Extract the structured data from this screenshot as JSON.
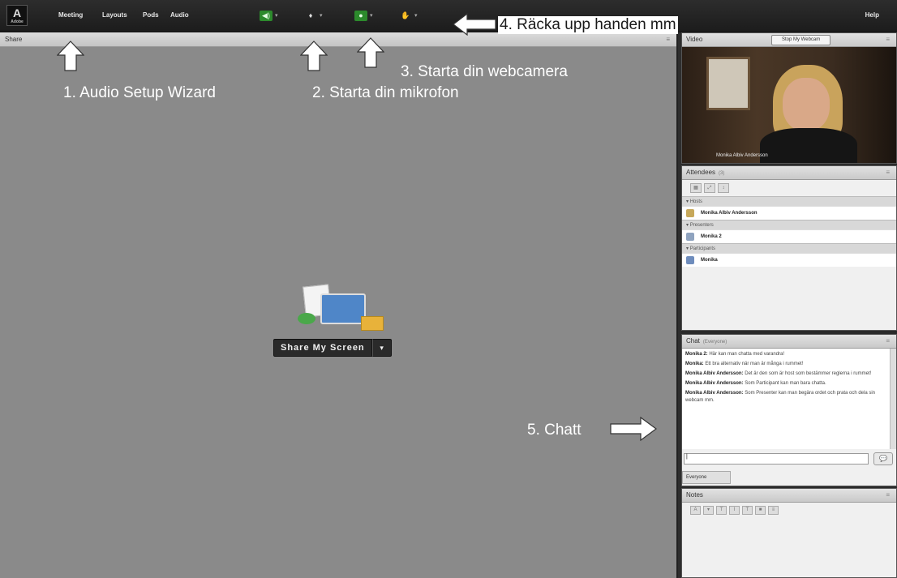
{
  "menubar": {
    "logo_text": "Adobe",
    "items": [
      "Meeting",
      "Layouts",
      "Pods",
      "Audio"
    ],
    "help": "Help"
  },
  "share": {
    "title": "Share",
    "menu_icon": "≡",
    "button_label": "Share My Screen",
    "dropdown": "▾"
  },
  "video": {
    "title": "Video",
    "webcam_button": "Stop My Webcam",
    "caption": "Monika Albiv Andersson"
  },
  "attendees": {
    "title": "Attendees",
    "count": "(3)",
    "groups": [
      {
        "label": "Hosts",
        "members": [
          "Monika Albiv Andersson"
        ]
      },
      {
        "label": "Presenters",
        "members": [
          "Monika 2"
        ]
      },
      {
        "label": "Participants",
        "members": [
          "Monika"
        ]
      }
    ]
  },
  "chat": {
    "title": "Chat",
    "scope": "(Everyone)",
    "messages": [
      {
        "sender": "Monika 2:",
        "text": "Här kan man chatta med varandra!"
      },
      {
        "sender": "Monika:",
        "text": "Ett bra alternativ när man är många i rummet!"
      },
      {
        "sender": "Monika Albiv Andersson:",
        "text": "Det är den som är host som bestämmer reglerna i rummet!"
      },
      {
        "sender": "Monika Albiv Andersson:",
        "text": "Som Participant kan man bara chatta."
      },
      {
        "sender": "Monika Albiv Andersson:",
        "text": "Som Presenter kan man begära ordet och prata och dela sin webcam mm."
      }
    ],
    "input_value": "|",
    "tab": "Everyone"
  },
  "notes": {
    "title": "Notes"
  },
  "annotations": {
    "a1": "1. Audio Setup Wizard",
    "a2": "2. Starta din mikrofon",
    "a3": "3. Starta din webcamera",
    "a4": "4. Räcka upp handen mm",
    "a5": "5. Chatt"
  },
  "colors": {
    "share_bg": "#8a8a8a",
    "menubar": "#1c1c1c",
    "active_green": "#2c8a2c"
  }
}
